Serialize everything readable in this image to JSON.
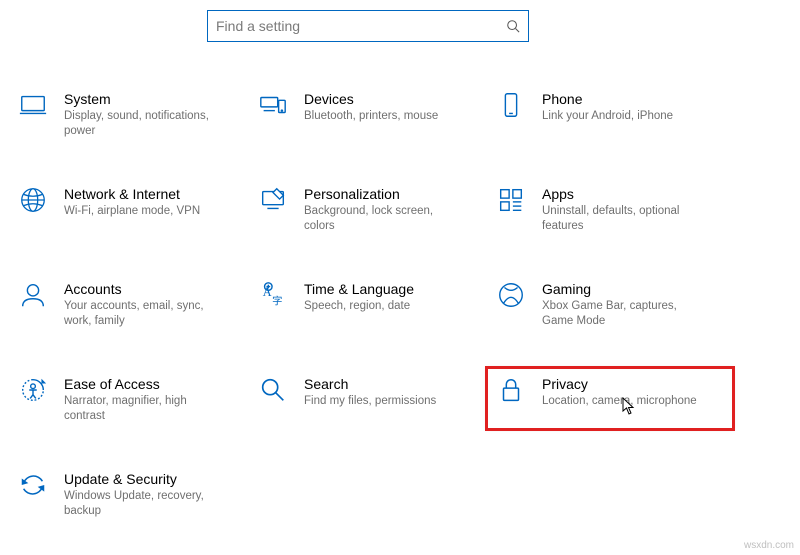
{
  "search": {
    "placeholder": "Find a setting"
  },
  "watermark": "wsxdn.com",
  "tiles": [
    {
      "title": "System",
      "desc": "Display, sound, notifications, power"
    },
    {
      "title": "Devices",
      "desc": "Bluetooth, printers, mouse"
    },
    {
      "title": "Phone",
      "desc": "Link your Android, iPhone"
    },
    {
      "title": "Network & Internet",
      "desc": "Wi-Fi, airplane mode, VPN"
    },
    {
      "title": "Personalization",
      "desc": "Background, lock screen, colors"
    },
    {
      "title": "Apps",
      "desc": "Uninstall, defaults, optional features"
    },
    {
      "title": "Accounts",
      "desc": "Your accounts, email, sync, work, family"
    },
    {
      "title": "Time & Language",
      "desc": "Speech, region, date"
    },
    {
      "title": "Gaming",
      "desc": "Xbox Game Bar, captures, Game Mode"
    },
    {
      "title": "Ease of Access",
      "desc": "Narrator, magnifier, high contrast"
    },
    {
      "title": "Search",
      "desc": "Find my files, permissions"
    },
    {
      "title": "Privacy",
      "desc": "Location, camera, microphone"
    },
    {
      "title": "Update & Security",
      "desc": "Windows Update, recovery, backup"
    }
  ]
}
